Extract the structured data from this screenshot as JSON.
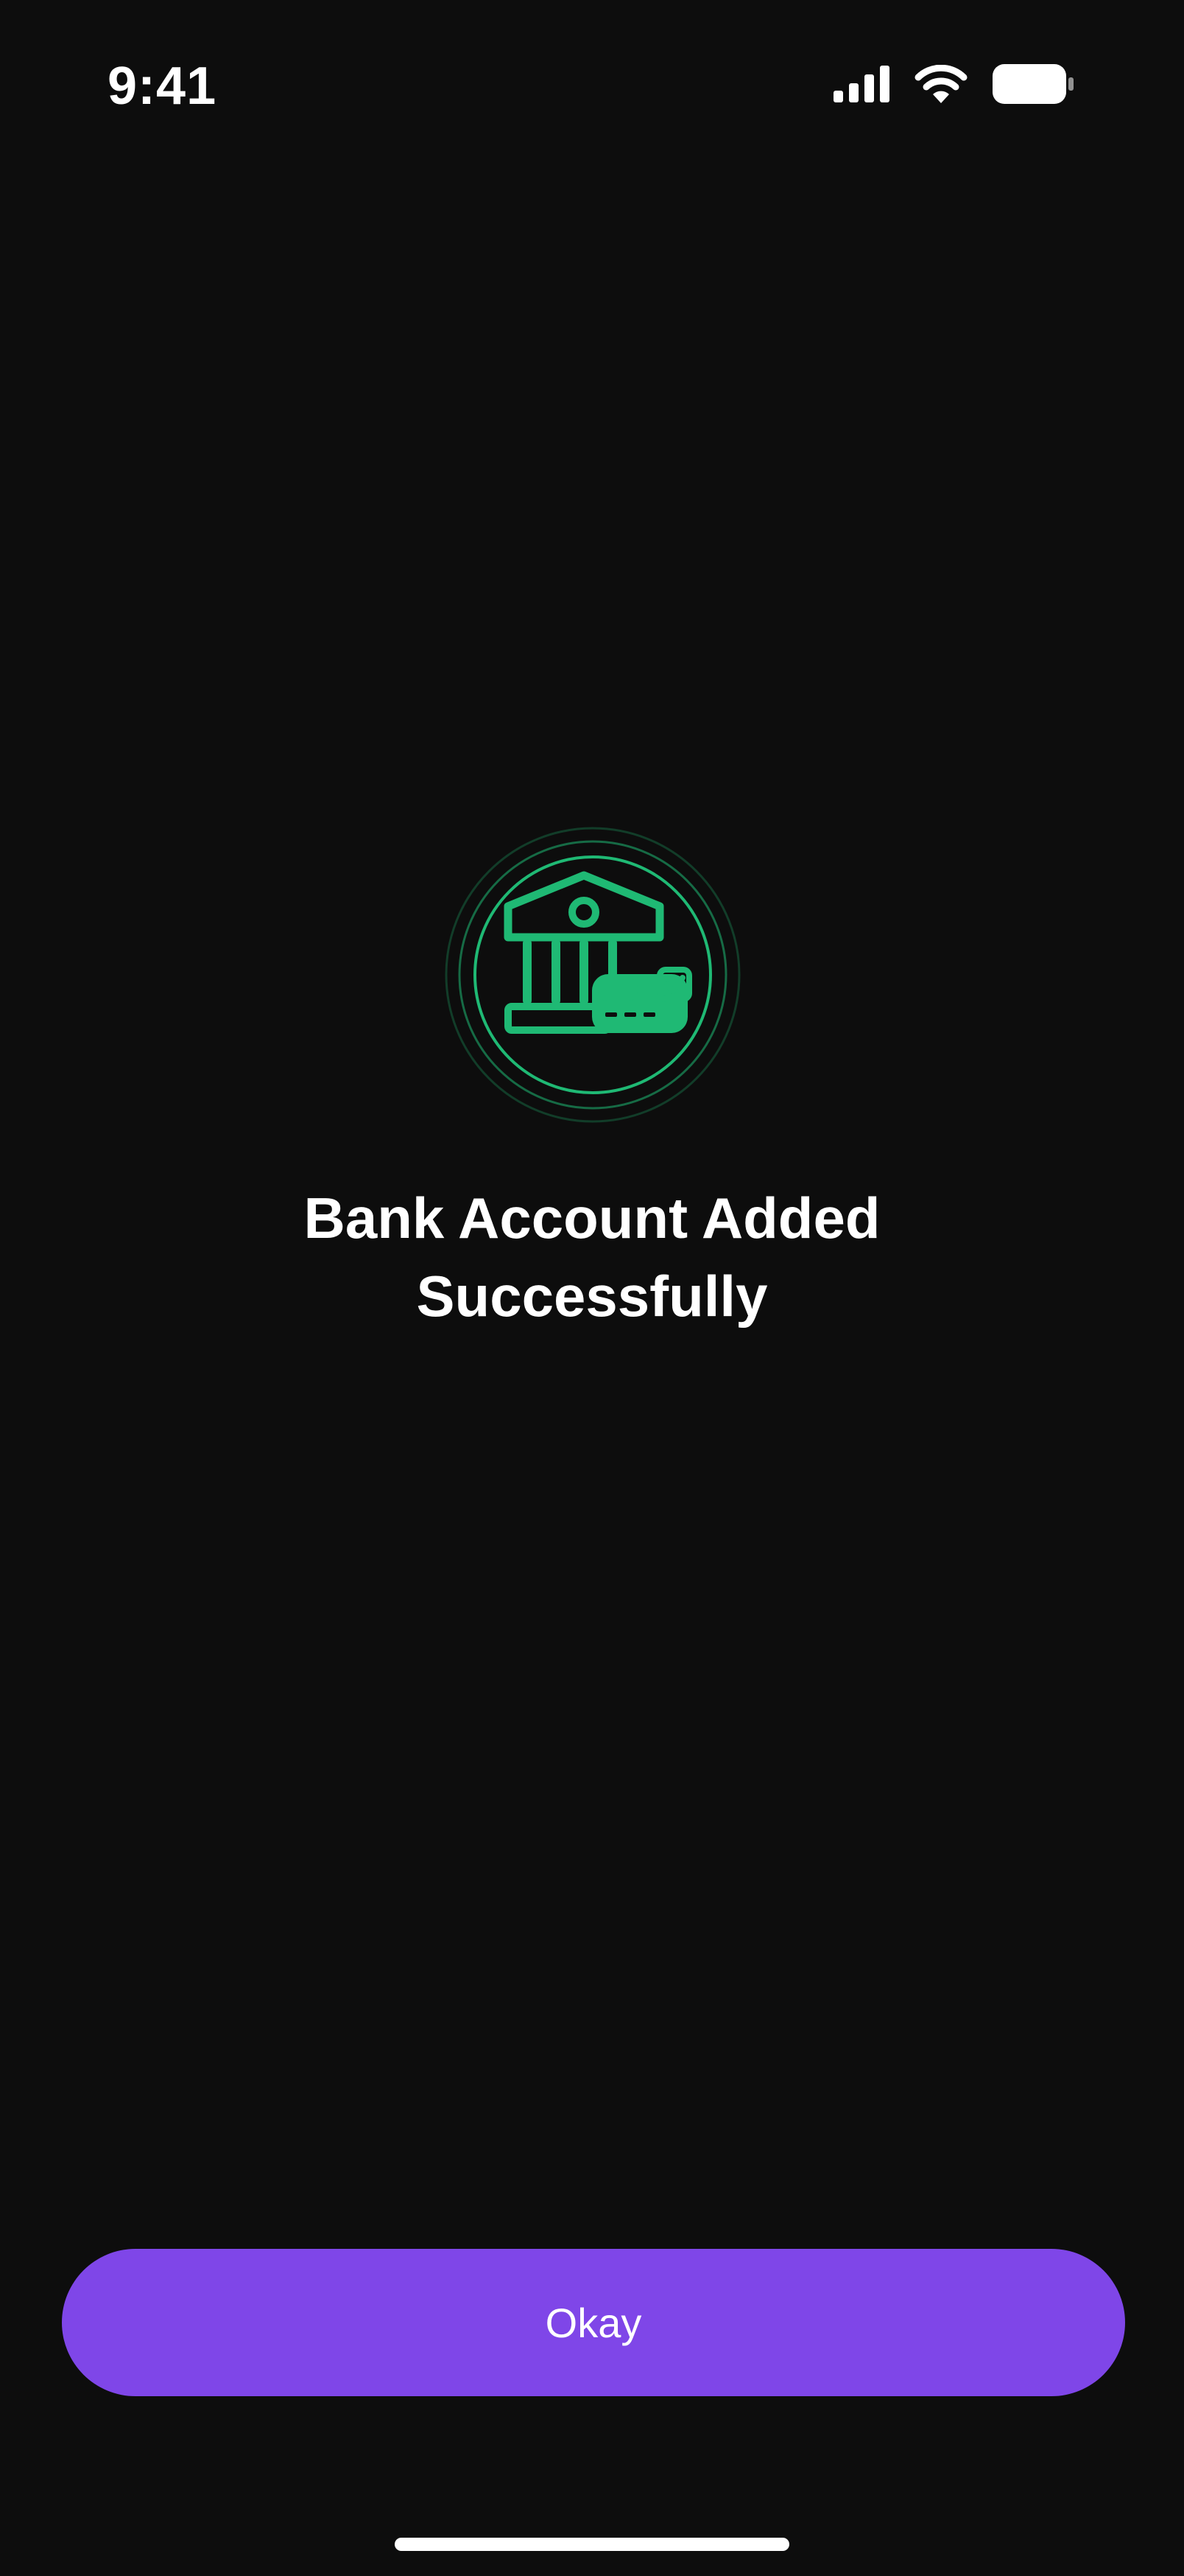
{
  "status_bar": {
    "time": "9:41",
    "icons": [
      "cellular-signal-icon",
      "wifi-icon",
      "battery-icon"
    ]
  },
  "success": {
    "icon": "bank-check-icon",
    "title": "Bank Account Added Successfully",
    "accent_color": "#1fb974"
  },
  "actions": {
    "okay_label": "Okay",
    "button_color": "#7f46e8"
  }
}
